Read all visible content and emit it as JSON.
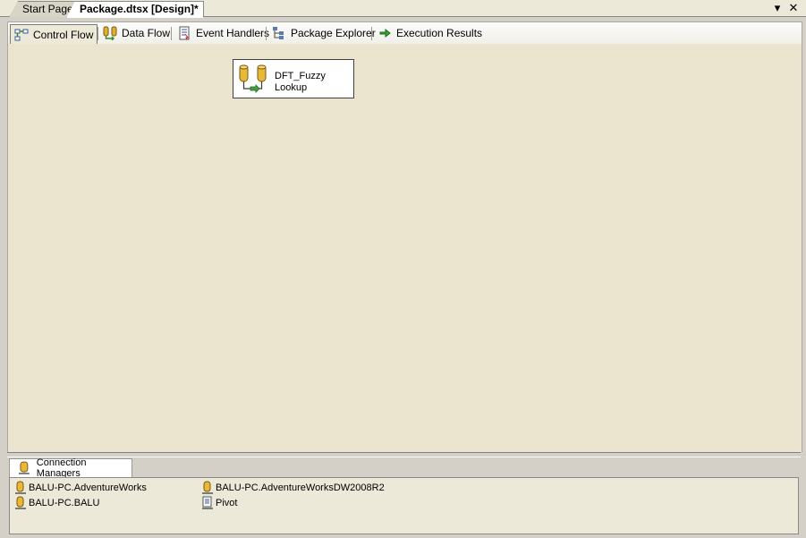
{
  "document_tabs": [
    {
      "label": "Start Page",
      "active": false
    },
    {
      "label": "Package.dtsx [Design]*",
      "active": true
    }
  ],
  "window_buttons": {
    "dropdown": "▾",
    "close": "✕"
  },
  "designer_tabs": [
    {
      "label": "Control Flow",
      "icon": "control-flow-icon",
      "selected": true
    },
    {
      "label": "Data Flow",
      "icon": "data-flow-icon",
      "selected": false
    },
    {
      "label": "Event Handlers",
      "icon": "event-handlers-icon",
      "selected": false
    },
    {
      "label": "Package Explorer",
      "icon": "package-explorer-icon",
      "selected": false
    },
    {
      "label": "Execution Results",
      "icon": "execution-results-icon",
      "selected": false
    }
  ],
  "canvas": {
    "background": "#ebe4cf",
    "task": {
      "label": "DFT_Fuzzy\nLookup",
      "icon": "data-flow-task-icon"
    }
  },
  "connection_managers": {
    "tab_label": "Connection Managers",
    "items": [
      {
        "label": "BALU-PC.AdventureWorks",
        "icon": "database-connection-icon"
      },
      {
        "label": "BALU-PC.BALU",
        "icon": "database-connection-icon"
      },
      {
        "label": "BALU-PC.AdventureWorksDW2008R2",
        "icon": "database-connection-icon"
      },
      {
        "label": "Pivot",
        "icon": "flat-file-connection-icon"
      }
    ]
  }
}
